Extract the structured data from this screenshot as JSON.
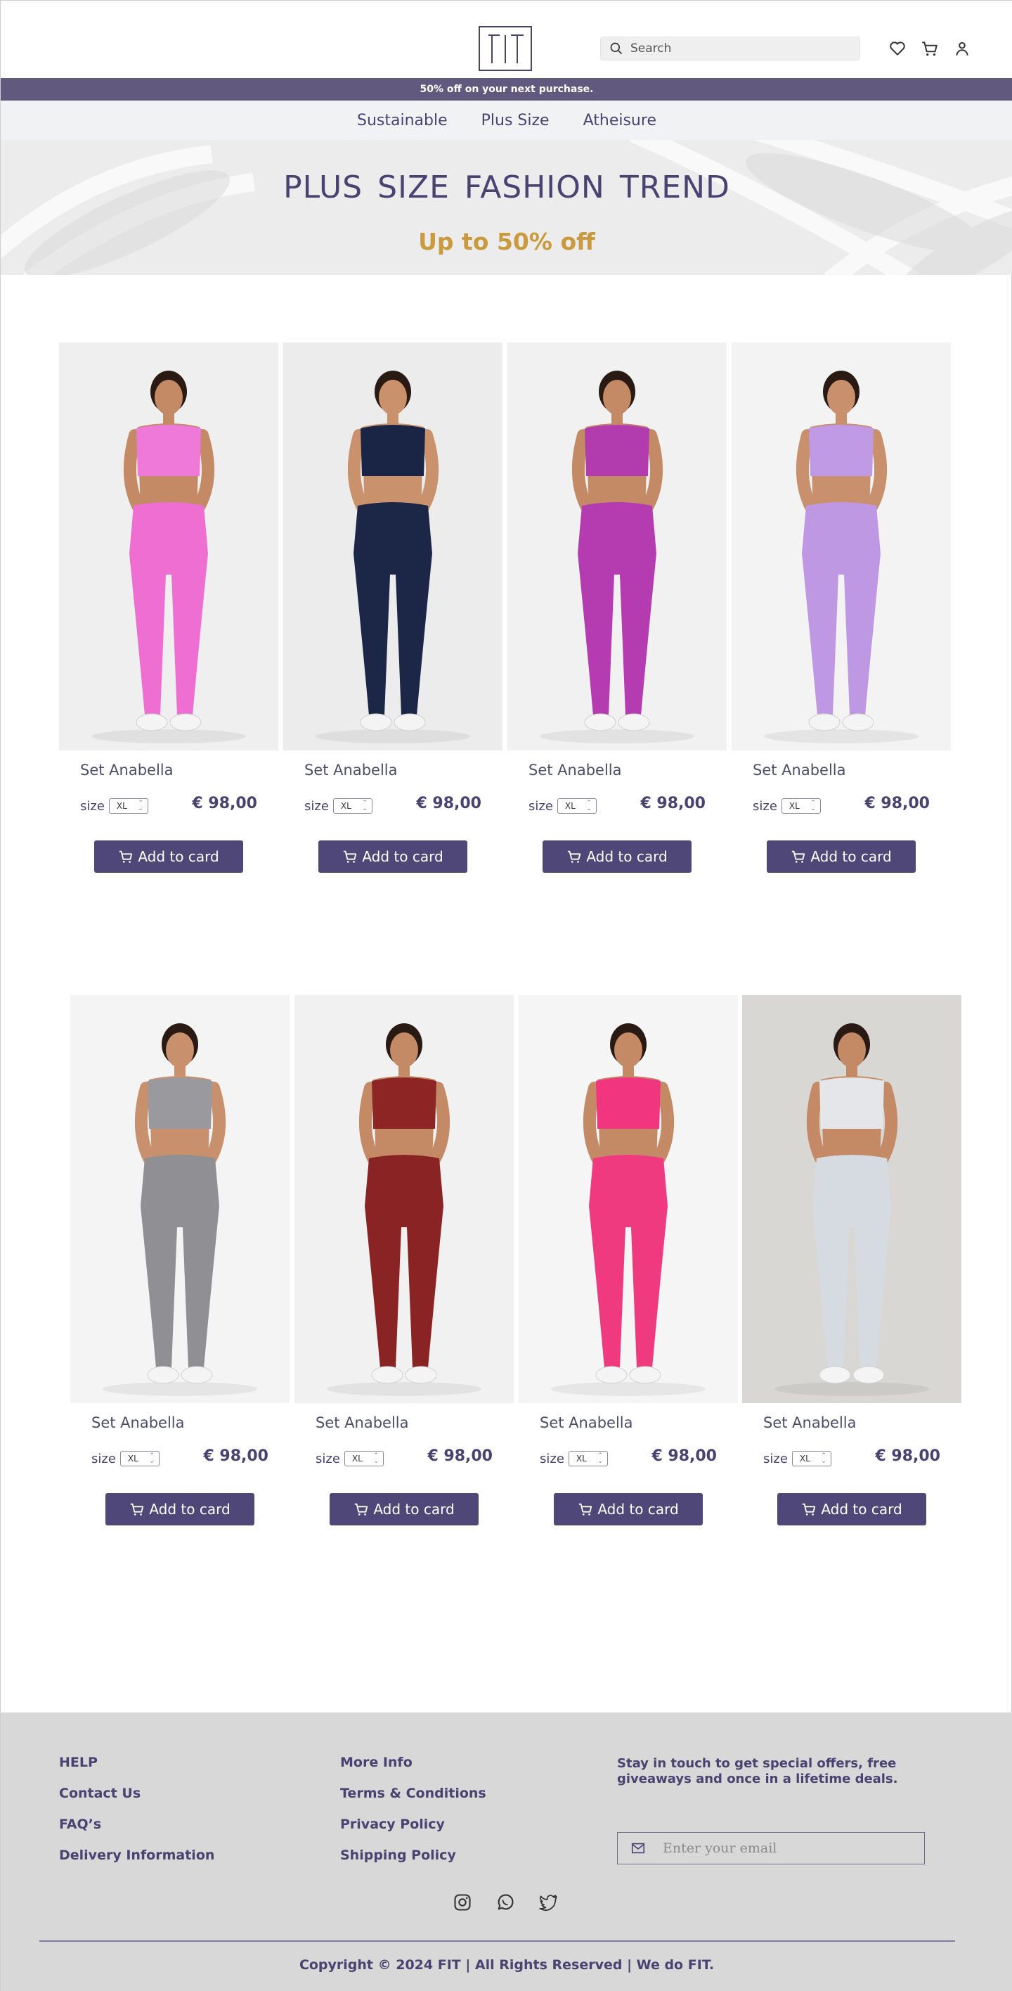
{
  "header": {
    "logo_text": "FIT",
    "search_placeholder": "Search"
  },
  "promo": {
    "text": "50% off on your next purchase."
  },
  "nav": {
    "items": [
      "Sustainable",
      "Plus Size",
      "Atheisure"
    ]
  },
  "hero": {
    "title": "PLUS SIZE  FASHION TREND",
    "subtitle": "Up to 50% off"
  },
  "products": [
    {
      "name": "Set Anabella",
      "size_label": "size",
      "size": "XL",
      "price": "€ 98,00",
      "button": "Add to card",
      "top_color": "#ef79d8",
      "bottom_color": "#ee6fd1",
      "skin": "#c48a66",
      "bg": "#efefef"
    },
    {
      "name": "Set Anabella",
      "size_label": "size",
      "size": "XL",
      "price": "€ 98,00",
      "button": "Add to card",
      "top_color": "#1a2445",
      "bottom_color": "#1c2647",
      "skin": "#c9916c",
      "bg": "#ececec"
    },
    {
      "name": "Set Anabella",
      "size_label": "size",
      "size": "XL",
      "price": "€ 98,00",
      "button": "Add to card",
      "top_color": "#b23cae",
      "bottom_color": "#b53bb1",
      "skin": "#c48a66",
      "bg": "#f1f1f1"
    },
    {
      "name": "Set Anabella",
      "size_label": "size",
      "size": "XL",
      "price": "€ 98,00",
      "button": "Add to card",
      "top_color": "#c09ae4",
      "bottom_color": "#bf98e4",
      "skin": "#c8906c",
      "bg": "#f3f3f3"
    },
    {
      "name": "Set Anabella",
      "size_label": "size",
      "size": "XL",
      "price": "€ 98,00",
      "button": "Add to card",
      "top_color": "#9a9a9e",
      "bottom_color": "#8f8f94",
      "skin": "#c8906c",
      "bg": "#f4f4f4"
    },
    {
      "name": "Set Anabella",
      "size_label": "size",
      "size": "XL",
      "price": "€ 98,00",
      "button": "Add to card",
      "top_color": "#8e2525",
      "bottom_color": "#8a2424",
      "skin": "#c48a66",
      "bg": "#f1f1f1"
    },
    {
      "name": "Set Anabella",
      "size_label": "size",
      "size": "XL",
      "price": "€ 98,00",
      "button": "Add to card",
      "top_color": "#f1357e",
      "bottom_color": "#ef3a80",
      "skin": "#c48a66",
      "bg": "#f5f5f5"
    },
    {
      "name": "Set Anabella",
      "size_label": "size",
      "size": "XL",
      "price": "€ 98,00",
      "button": "Add to card",
      "top_color": "#e4e6ea",
      "bottom_color": "#d6dbe2",
      "skin": "#c48a66",
      "bg": "#d9d7d4"
    }
  ],
  "footer": {
    "col1": [
      "HELP",
      "Contact Us",
      "FAQ’s",
      "Delivery Information"
    ],
    "col2": [
      "More Info",
      "Terms & Conditions",
      "Privacy Policy",
      "Shipping Policy"
    ],
    "newsletter_text": "Stay in touch to get special offers, free giveaways and once in a lifetime deals.",
    "email_placeholder": "Enter your email",
    "copyright": "Copyright © 2024 FIT | All Rights Reserved |  We do FIT."
  },
  "colors": {
    "brand": "#4e4778",
    "accent": "#c99a3e",
    "promo_bg": "#625a7e"
  },
  "icons": [
    "search-icon",
    "heart-icon",
    "cart-icon",
    "user-icon",
    "mail-icon",
    "instagram-icon",
    "whatsapp-icon",
    "twitter-icon"
  ]
}
